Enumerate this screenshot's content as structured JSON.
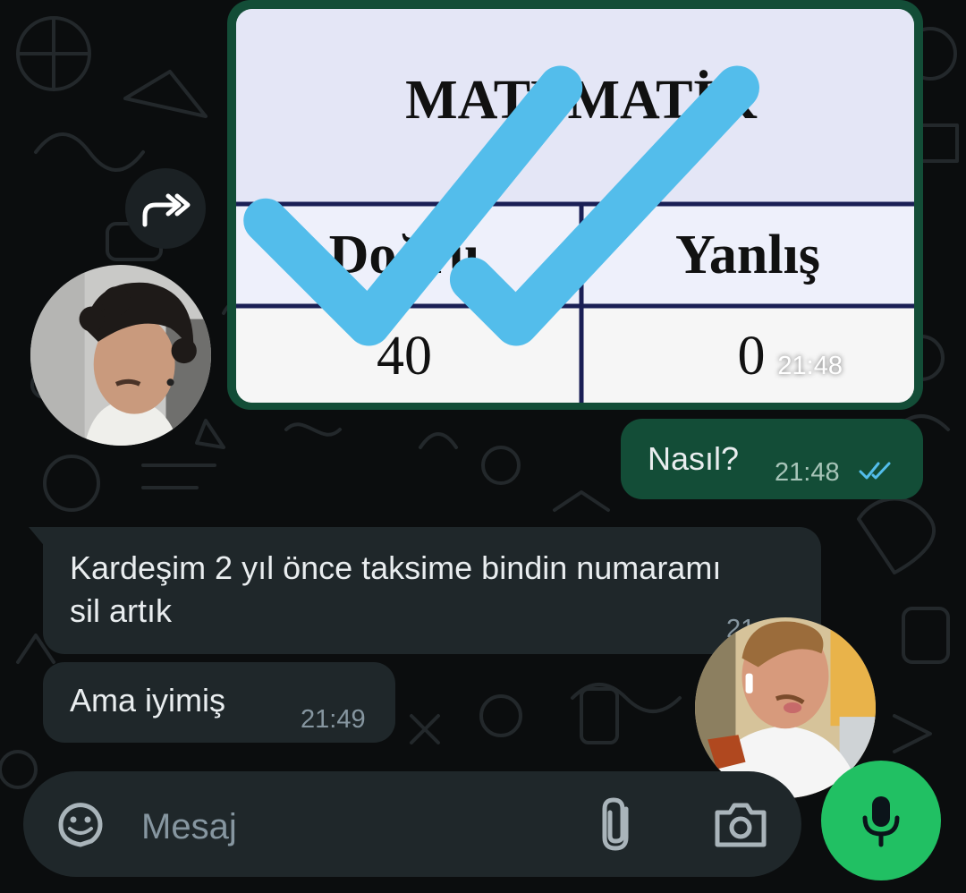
{
  "theme": {
    "accent": "#21c063",
    "outgoing_bubble": "#134d37",
    "incoming_bubble": "#1f272a",
    "background": "#0b0d0e",
    "read_tick": "#53bdeb"
  },
  "messages": [
    {
      "type": "image",
      "direction": "outgoing",
      "time": "21:48",
      "status": "read",
      "image_content": {
        "title": "MATEMATİK",
        "headers": [
          "Doğru",
          "Yanlış"
        ],
        "values": [
          "40",
          "0"
        ]
      }
    },
    {
      "type": "text",
      "direction": "outgoing",
      "text": "Nasıl?",
      "time": "21:48",
      "status": "read"
    },
    {
      "type": "text",
      "direction": "incoming",
      "text": "Kardeşim 2 yıl önce taksime bindin numaramı sil artık",
      "time": "21"
    },
    {
      "type": "text",
      "direction": "incoming",
      "text": "Ama iyimiş",
      "time": "21:49"
    }
  ],
  "icons": {
    "forward": "forward-icon",
    "emoji": "sticker-icon",
    "attach": "paperclip-icon",
    "camera": "camera-icon",
    "mic": "microphone-icon",
    "read_receipt": "double-check-icon"
  },
  "input": {
    "placeholder": "Mesaj",
    "value": ""
  }
}
